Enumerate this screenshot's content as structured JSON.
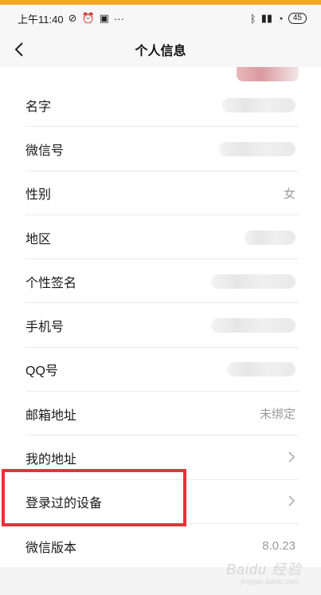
{
  "status_bar": {
    "time": "上午11:40",
    "battery": "45",
    "icons_left": [
      "alarm-off-icon",
      "alarm-icon",
      "app-icon",
      "more-icon"
    ],
    "icons_right": [
      "bluetooth-icon",
      "signal-icon",
      "wifi-icon"
    ]
  },
  "header": {
    "title": "个人信息"
  },
  "rows": [
    {
      "label": "名字",
      "value": ""
    },
    {
      "label": "微信号",
      "value": ""
    },
    {
      "label": "性别",
      "value": "女"
    },
    {
      "label": "地区",
      "value": ""
    },
    {
      "label": "个性签名",
      "value": ""
    },
    {
      "label": "手机号",
      "value": ""
    },
    {
      "label": "QQ号",
      "value": ""
    },
    {
      "label": "邮箱地址",
      "value": "未绑定"
    },
    {
      "label": "我的地址",
      "value": ""
    },
    {
      "label": "登录过的设备",
      "value": ""
    },
    {
      "label": "微信版本",
      "value": "8.0.23"
    }
  ],
  "watermark": {
    "text": "Baidu 经验",
    "sub": "jingyan.baidu.com"
  },
  "colors": {
    "accent_bar": "#f5a623",
    "highlight": "#e8313a"
  }
}
